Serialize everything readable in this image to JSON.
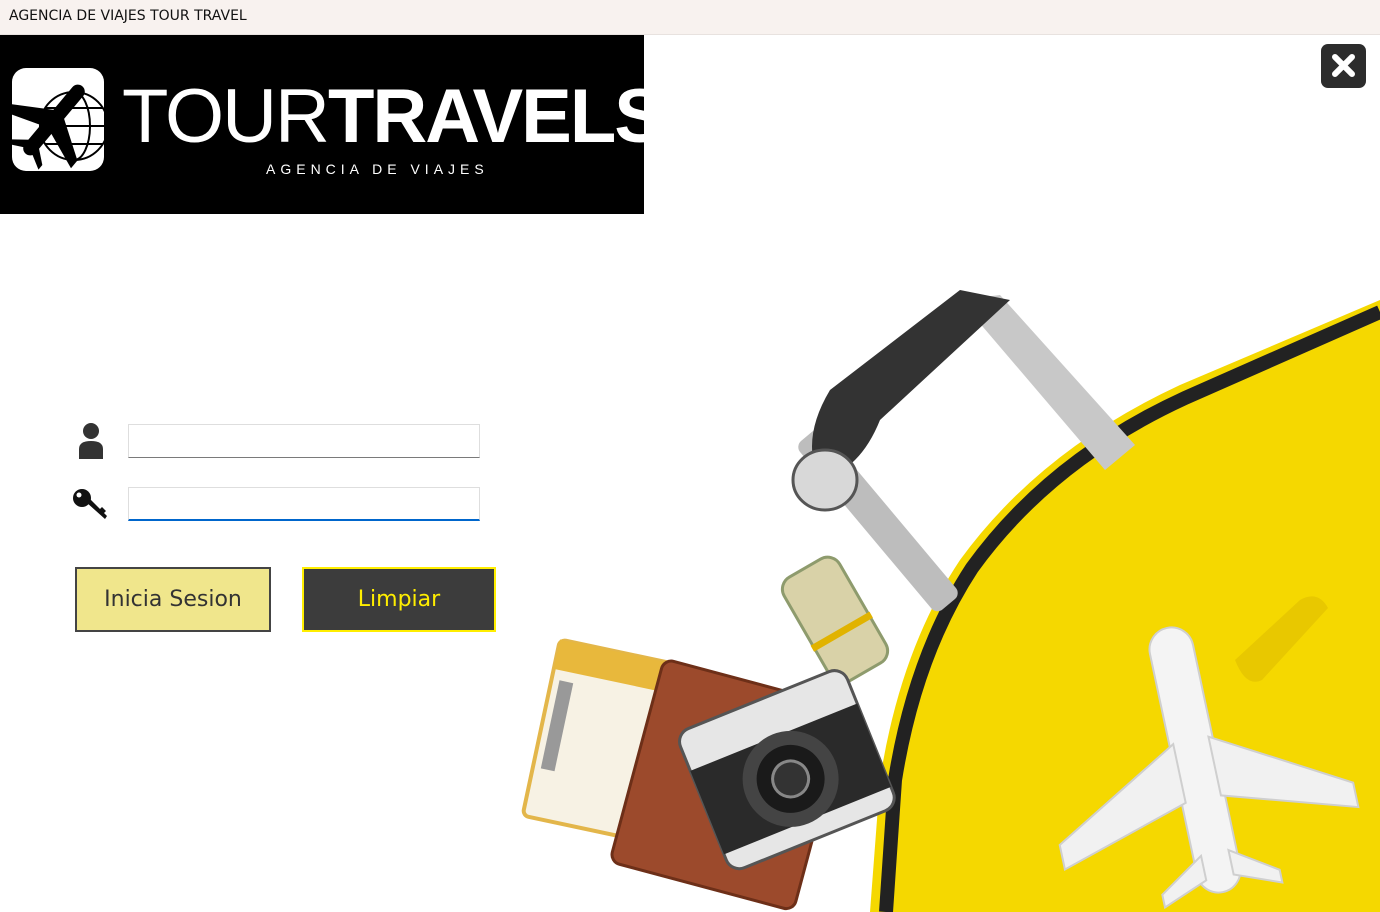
{
  "window": {
    "title": "AGENCIA DE VIAJES TOUR TRAVEL"
  },
  "logo": {
    "brand_light": "TOUR",
    "brand_bold": "TRAVELS",
    "tagline": "AGENCIA DE VIAJES",
    "icon": "plane-globe-icon"
  },
  "close": {
    "symbol": "✖",
    "icon": "close-icon"
  },
  "login": {
    "username_icon": "user-icon",
    "password_icon": "key-icon",
    "username_value": "",
    "password_value": ""
  },
  "buttons": {
    "login_label": "Inicia Sesion",
    "clear_label": "Limpiar"
  },
  "colors": {
    "login_button_bg": "#f0e68c",
    "clear_button_bg": "#3c3c3c",
    "clear_button_text": "#ffee00",
    "suitcase": "#f5d800",
    "logo_bg": "#000000"
  }
}
